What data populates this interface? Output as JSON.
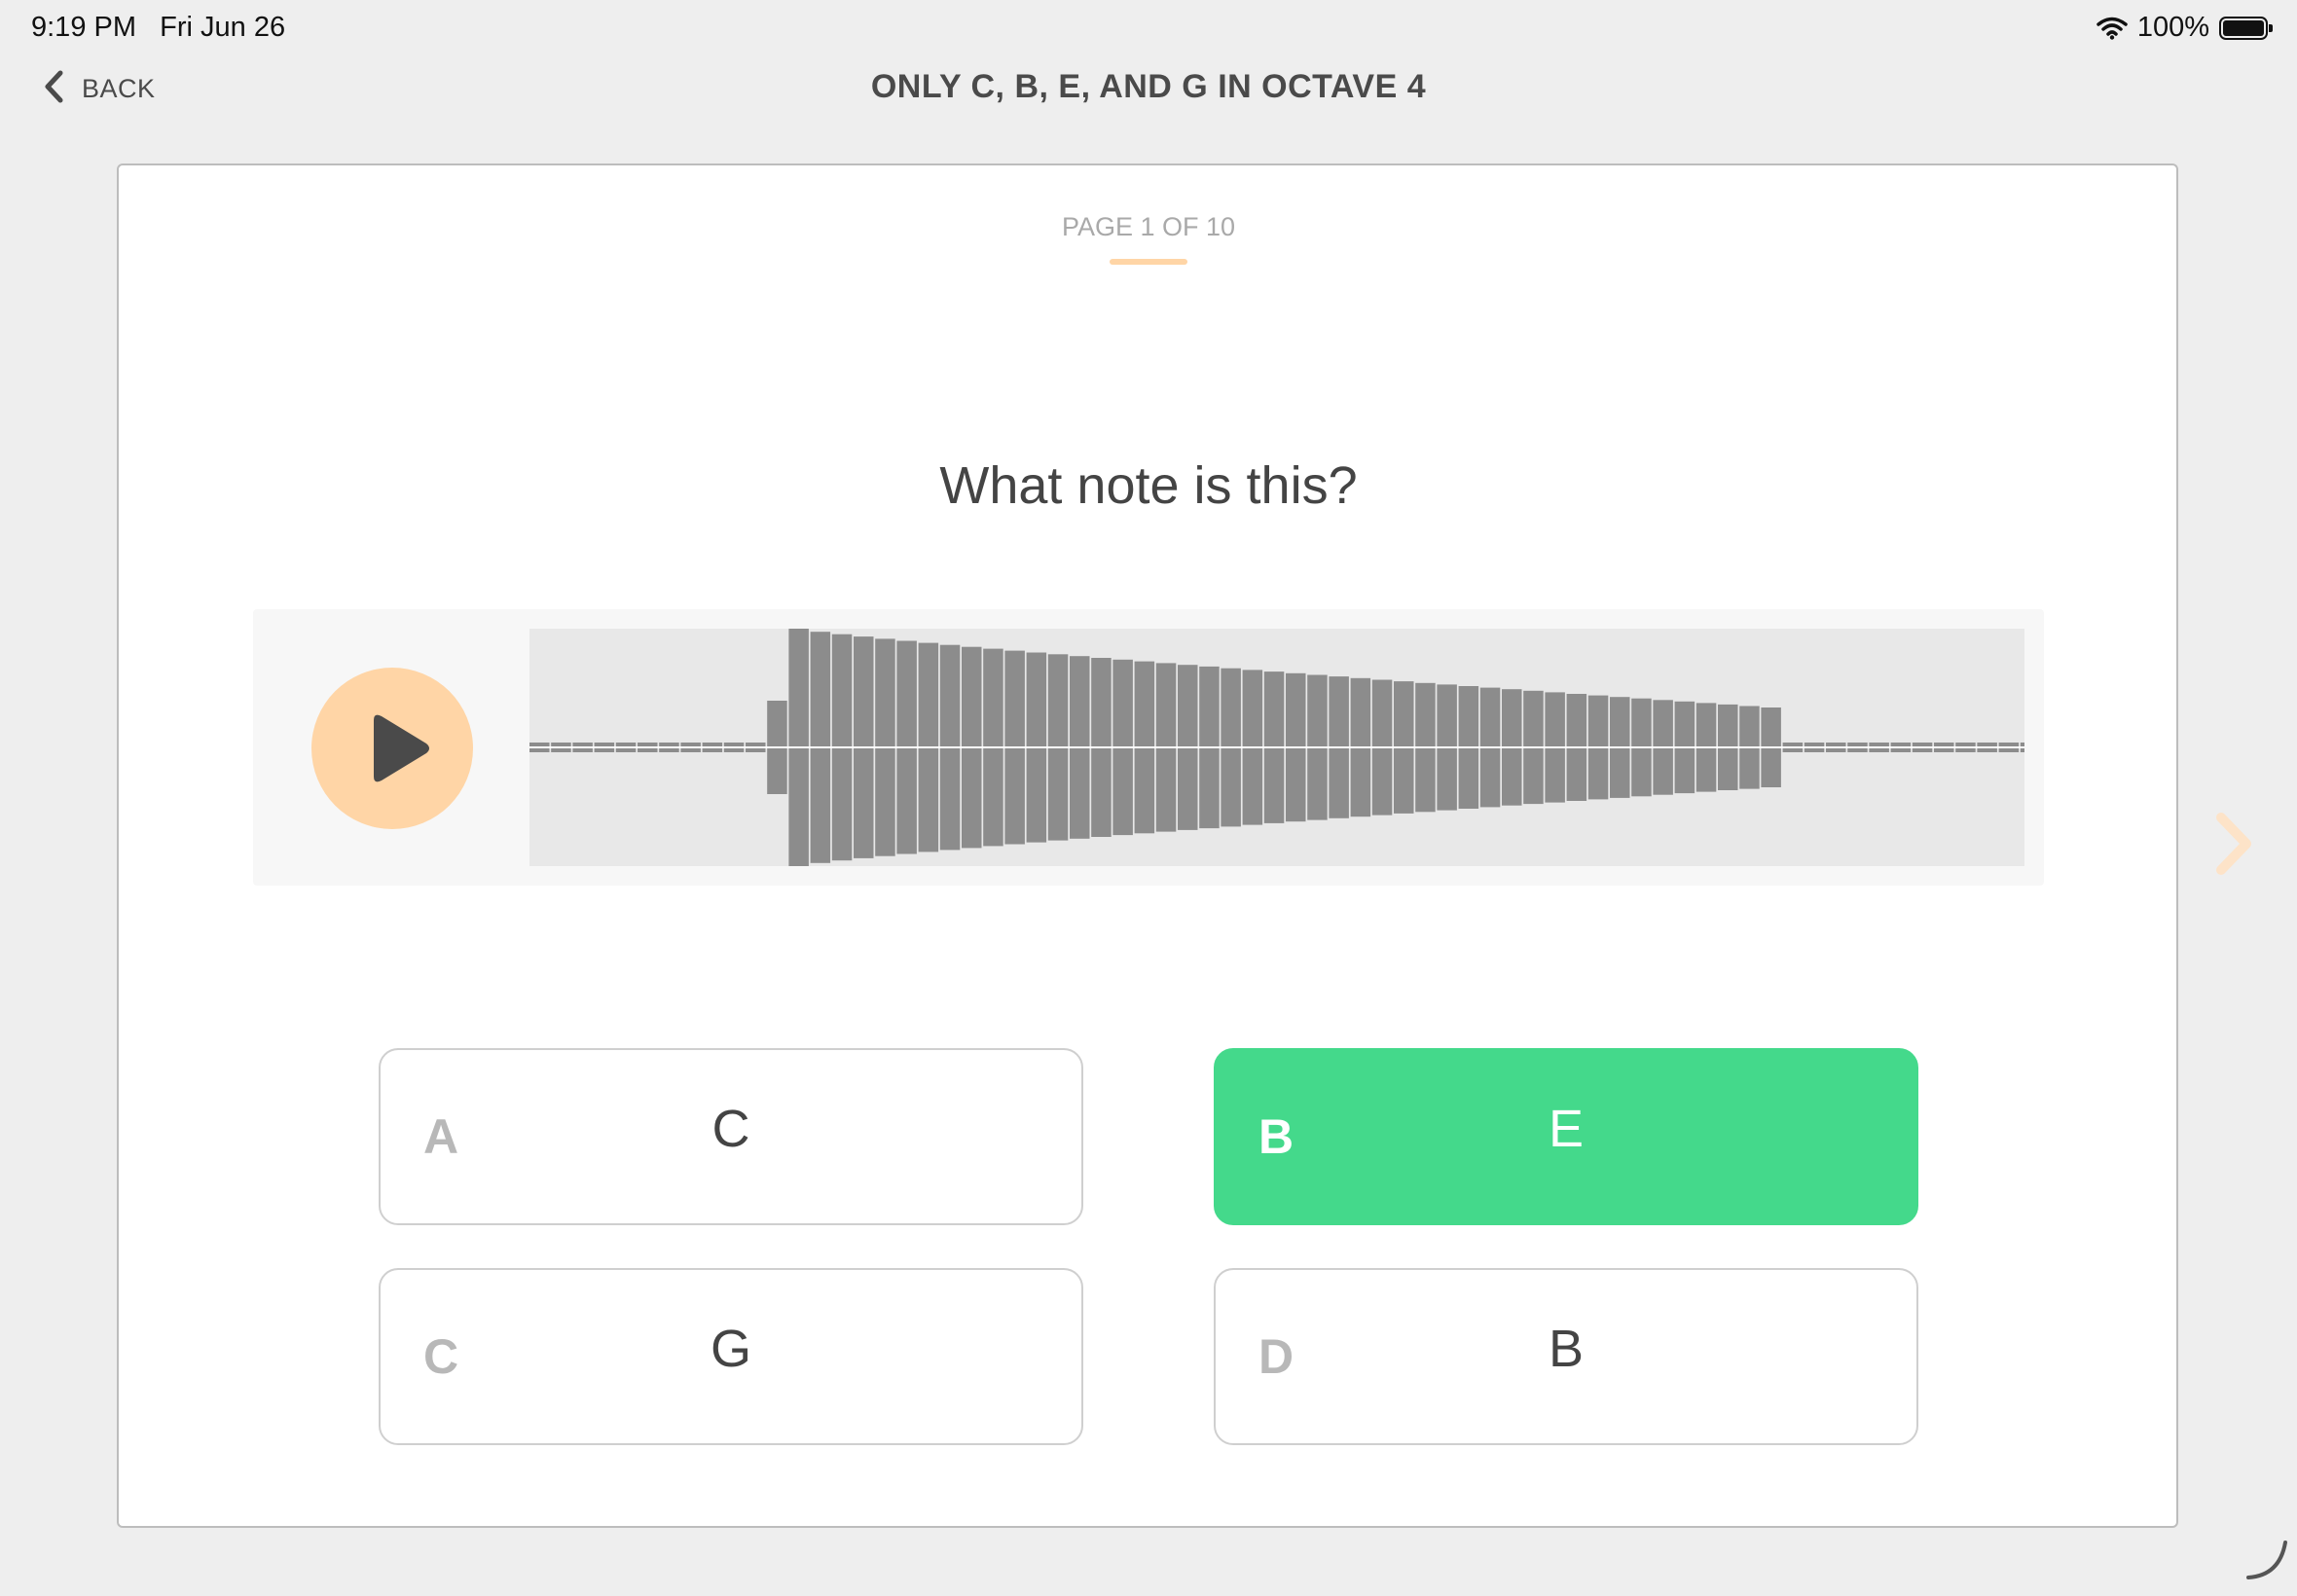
{
  "status_bar": {
    "time": "9:19 PM",
    "date": "Fri Jun 26",
    "battery": "100%"
  },
  "nav": {
    "back_label": "BACK",
    "title": "ONLY C, B, E, AND G IN OCTAVE 4"
  },
  "quiz": {
    "page_indicator": "PAGE 1 OF 10",
    "question": "What note is this?",
    "answers": [
      {
        "letter": "A",
        "value": "C",
        "selected": false
      },
      {
        "letter": "B",
        "value": "E",
        "selected": true
      },
      {
        "letter": "C",
        "value": "G",
        "selected": false
      },
      {
        "letter": "D",
        "value": "B",
        "selected": false
      }
    ]
  },
  "icons": {
    "back": "chevron-left-icon",
    "play": "play-icon",
    "next": "chevron-right-icon",
    "wifi": "wifi-icon",
    "battery": "battery-icon"
  },
  "colors": {
    "accent_orange": "#ffd5a6",
    "selected_green": "#44d98b",
    "waveform": "#8c8c8c"
  }
}
